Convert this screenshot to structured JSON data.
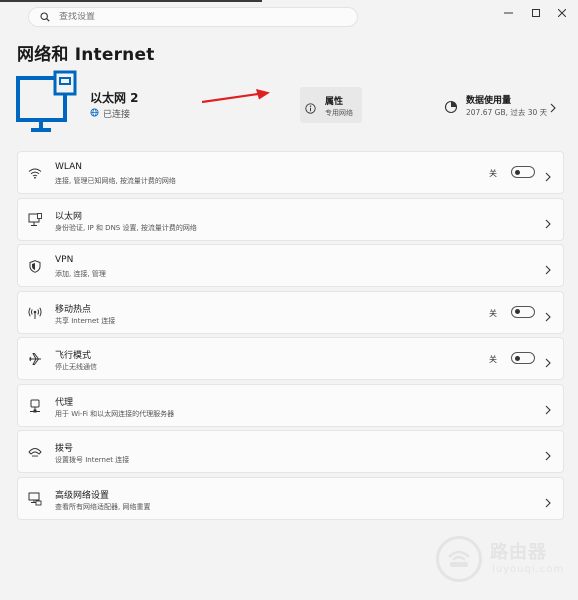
{
  "search": {
    "placeholder": "查找设置"
  },
  "window_controls": {
    "minimize": "—",
    "maximize": "□",
    "close": "✕"
  },
  "page": {
    "title": "网络和 Internet"
  },
  "connection": {
    "name": "以太网 2",
    "status": "已连接",
    "icon": "monitor-network-icon",
    "accent": "#0067c0"
  },
  "properties_card": {
    "title": "属性",
    "subtitle": "专用网络",
    "icon": "info-icon"
  },
  "data_usage_card": {
    "title": "数据使用量",
    "subtitle": "207.67 GB, 过去 30 天",
    "icon": "pie-chart-icon"
  },
  "annotation": {
    "color": "#e02020",
    "shape": "arrow"
  },
  "rows": [
    {
      "title": "WLAN",
      "subtitle": "连接, 管理已知网络, 按流量计费的网络",
      "icon": "wifi-icon",
      "state": "关",
      "toggle": false
    },
    {
      "title": "以太网",
      "subtitle": "身份验证, IP 和 DNS 设置, 按流量计费的网络",
      "icon": "ethernet-icon"
    },
    {
      "title": "VPN",
      "subtitle": "添加, 连接, 管理",
      "icon": "shield-icon"
    },
    {
      "title": "移动热点",
      "subtitle": "共享 Internet 连接",
      "icon": "hotspot-icon",
      "state": "关",
      "toggle": false
    },
    {
      "title": "飞行模式",
      "subtitle": "停止无线通信",
      "icon": "airplane-icon",
      "state": "关",
      "toggle": false
    },
    {
      "title": "代理",
      "subtitle": "用于 Wi-Fi 和以太网连接的代理服务器",
      "icon": "proxy-icon"
    },
    {
      "title": "拨号",
      "subtitle": "设置拨号 Internet 连接",
      "icon": "dialup-icon"
    },
    {
      "title": "高级网络设置",
      "subtitle": "查看所有网络适配器, 网络重置",
      "icon": "advanced-network-icon"
    }
  ],
  "watermark": {
    "title": "路由器",
    "subtitle": "luyouqi.com"
  }
}
